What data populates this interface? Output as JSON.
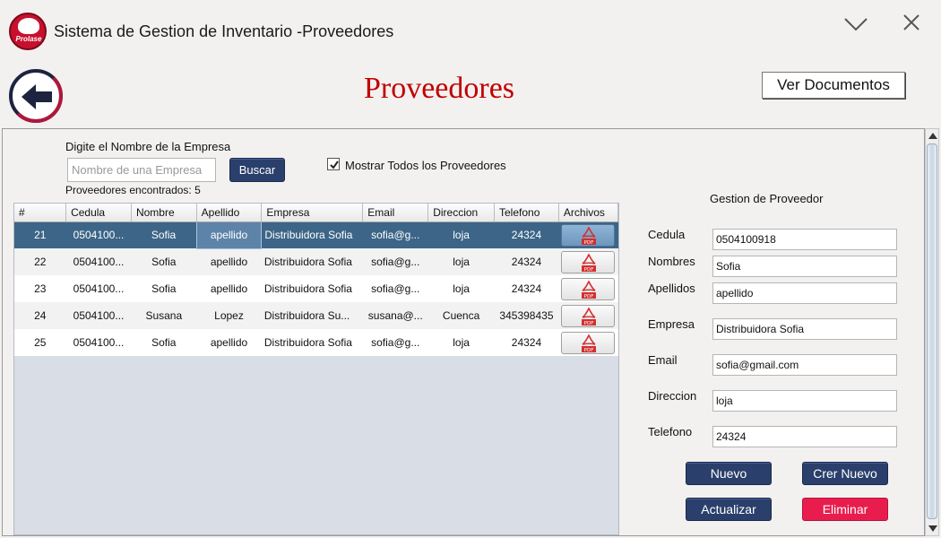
{
  "window": {
    "logo_text": "Prolase",
    "title": "Sistema de Gestion de Inventario -Proveedores"
  },
  "header": {
    "page_title": "Proveedores",
    "docs_button": "Ver Documentos"
  },
  "search": {
    "label": "Digite el Nombre de la Empresa",
    "placeholder": "Nombre de una Empresa",
    "value": "",
    "button": "Buscar",
    "show_all_label": "Mostrar Todos los Proveedores",
    "show_all_checked": true,
    "found_text": "Proveedores encontrados: 5"
  },
  "table": {
    "columns": [
      "#",
      "Cedula",
      "Nombre",
      "Apellido",
      "Empresa",
      "Email",
      "Direccion",
      "Telefono",
      "Archivos"
    ],
    "rows": [
      {
        "id": "21",
        "cedula": "0504100...",
        "nombre": "Sofia",
        "apellido": "apellido",
        "empresa": "Distribuidora Sofia",
        "email": "sofia@g...",
        "direccion": "loja",
        "telefono": "24324",
        "selected": true
      },
      {
        "id": "22",
        "cedula": "0504100...",
        "nombre": "Sofia",
        "apellido": "apellido",
        "empresa": "Distribuidora Sofia",
        "email": "sofia@g...",
        "direccion": "loja",
        "telefono": "24324"
      },
      {
        "id": "23",
        "cedula": "0504100...",
        "nombre": "Sofia",
        "apellido": "apellido",
        "empresa": "Distribuidora Sofia",
        "email": "sofia@g...",
        "direccion": "loja",
        "telefono": "24324"
      },
      {
        "id": "24",
        "cedula": "0504100...",
        "nombre": "Susana",
        "apellido": "Lopez",
        "empresa": "Distribuidora Su...",
        "email": "susana@...",
        "direccion": "Cuenca",
        "telefono": "345398435"
      },
      {
        "id": "25",
        "cedula": "0504100...",
        "nombre": "Sofia",
        "apellido": "apellido",
        "empresa": "Distribuidora Sofia",
        "email": "sofia@g...",
        "direccion": "loja",
        "telefono": "24324"
      }
    ],
    "pdf_icon_text": "PDF"
  },
  "form": {
    "title": "Gestion de Proveedor",
    "cedula_label": "Cedula",
    "cedula_value": "0504100918",
    "nombres_label": "Nombres",
    "nombres_value": "Sofia",
    "apellidos_label": "Apellidos",
    "apellidos_value": "apellido",
    "empresa_label": "Empresa",
    "empresa_value": "Distribuidora Sofia",
    "email_label": "Email",
    "email_value": "sofia@gmail.com",
    "direccion_label": "Direccion",
    "direccion_value": "loja",
    "telefono_label": "Telefono",
    "telefono_value": "24324",
    "btn_nuevo": "Nuevo",
    "btn_crear": "Crer Nuevo",
    "btn_actualizar": "Actualizar",
    "btn_eliminar": "Eliminar"
  },
  "colors": {
    "accent_blue": "#2a3f6b",
    "danger": "#e81d4e",
    "title_red": "#c00000",
    "selected_row": "#3c6587"
  }
}
